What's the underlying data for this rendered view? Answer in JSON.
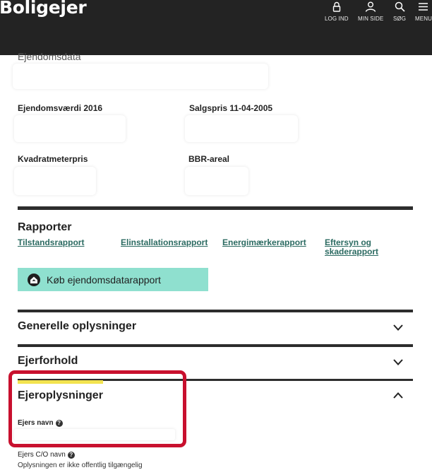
{
  "header": {
    "logo": "Boligejer",
    "nav": [
      {
        "label": "LOG IND",
        "icon": "lock-icon"
      },
      {
        "label": "MIN SIDE",
        "icon": "user-icon"
      },
      {
        "label": "SØG",
        "icon": "search-icon"
      },
      {
        "label": "MENU",
        "icon": "menu-icon"
      }
    ]
  },
  "property": {
    "section_title": "Ejendomsdata",
    "fields": [
      {
        "label": "Ejendomsværdi 2016"
      },
      {
        "label": "Salgspris 11-04-2005"
      },
      {
        "label": "Kvadratmeterpris"
      },
      {
        "label": "BBR-areal"
      }
    ]
  },
  "reports": {
    "title": "Rapporter",
    "links": [
      "Tilstandsrapport",
      "Elinstallationsrapport",
      "Energimærkerapport",
      "Eftersyn og skaderapport"
    ],
    "buy_button": "Køb ejendomsdatarapport"
  },
  "accordion": [
    {
      "title": "Generelle oplysninger",
      "state": "collapsed"
    },
    {
      "title": "Ejerforhold",
      "state": "collapsed"
    },
    {
      "title": "Ejeroplysninger",
      "state": "expanded"
    }
  ],
  "owner_info": {
    "owner_name_label": "Ejers navn",
    "owner_co_label": "Ejers C/O navn",
    "not_public_note": "Oplysningen er ikke offentlig tilgængelig"
  },
  "colors": {
    "header_bg": "#232323",
    "accent_mint": "#8fe0cf",
    "link_green": "#2c6b62",
    "highlight_red": "#c8102e",
    "active_yellow": "#f2e34f"
  }
}
